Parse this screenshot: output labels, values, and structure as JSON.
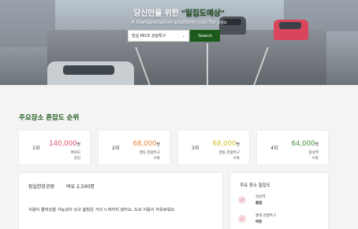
{
  "hero": {
    "title_prefix": "당신만을 위한 ",
    "title_accent": "\"밀집도예상\"",
    "subtitle": "A transportation platform just for you",
    "select_value": "잠실 MICE 관광특구",
    "search_label": "Search"
  },
  "section": {
    "title": "주요장소 혼잡도 순위"
  },
  "ranking": [
    {
      "rank": "1위",
      "count": "140,000",
      "unit": "명",
      "place": "여의도",
      "status": "붐빔",
      "color": "#e0506a"
    },
    {
      "rank": "2위",
      "count": "68,000",
      "unit": "명",
      "place": "명동 관광특구",
      "status": "보통",
      "color": "#e8863c"
    },
    {
      "rank": "3위",
      "count": "68,000",
      "unit": "명",
      "place": "명동 관광특구",
      "status": "보통",
      "color": "#d3c22a"
    },
    {
      "rank": "4위",
      "count": "64,000",
      "unit": "명",
      "place": "잠실역",
      "status": "보통",
      "color": "#3e8e3e"
    }
  ],
  "detail": {
    "place": "잠실한강공원",
    "population": "여유 2,500명",
    "description": "사람이 몰려있을 가능성이 낮고 붐빔은 거의 느껴지지 않아요. 도보 이동이 자유로워요."
  },
  "side": {
    "title": "주요 장소 밀집도",
    "items": [
      {
        "name": "강남역",
        "status": "붐빔"
      },
      {
        "name": "홍대 관광특구",
        "status": "여유"
      }
    ]
  }
}
